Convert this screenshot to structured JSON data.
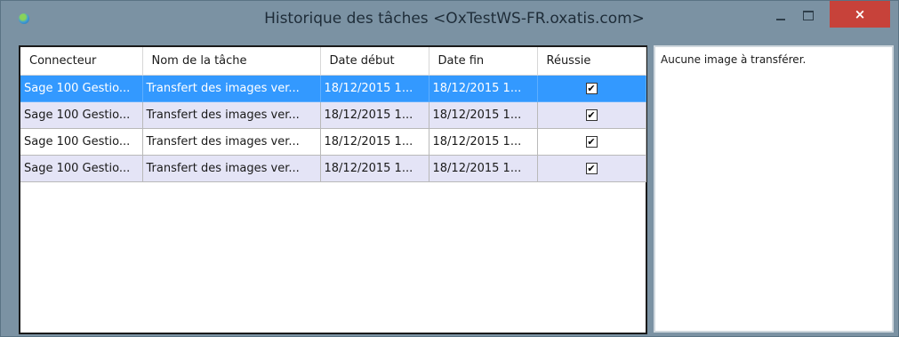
{
  "window": {
    "title": "Historique des tâches <OxTestWS-FR.oxatis.com>",
    "minimize_label": "–",
    "maximize_label": "□",
    "close_label": "×"
  },
  "grid": {
    "columns": [
      "Connecteur",
      "Nom de la tâche",
      "Date début",
      "Date fin",
      "Réussie"
    ],
    "rows": [
      {
        "connecteur": "Sage 100 Gestio...",
        "nom": "Transfert des images ver...",
        "debut": "18/12/2015 1...",
        "fin": "18/12/2015 1...",
        "reussie": "✔",
        "state": "selected"
      },
      {
        "connecteur": "Sage 100 Gestio...",
        "nom": "Transfert des images ver...",
        "debut": "18/12/2015 1...",
        "fin": "18/12/2015 1...",
        "reussie": "✔",
        "state": "alt"
      },
      {
        "connecteur": "Sage 100 Gestio...",
        "nom": "Transfert des images ver...",
        "debut": "18/12/2015 1...",
        "fin": "18/12/2015 1...",
        "reussie": "✔",
        "state": "normal"
      },
      {
        "connecteur": "Sage 100 Gestio...",
        "nom": "Transfert des images ver...",
        "debut": "18/12/2015 1...",
        "fin": "18/12/2015 1...",
        "reussie": "✔",
        "state": "alt"
      }
    ]
  },
  "details": {
    "text": "Aucune image à transférer."
  },
  "colors": {
    "titlebar": "#7b92a3",
    "selected_row": "#3399ff",
    "alt_row": "#e4e4f6",
    "close_button": "#c7423a"
  }
}
